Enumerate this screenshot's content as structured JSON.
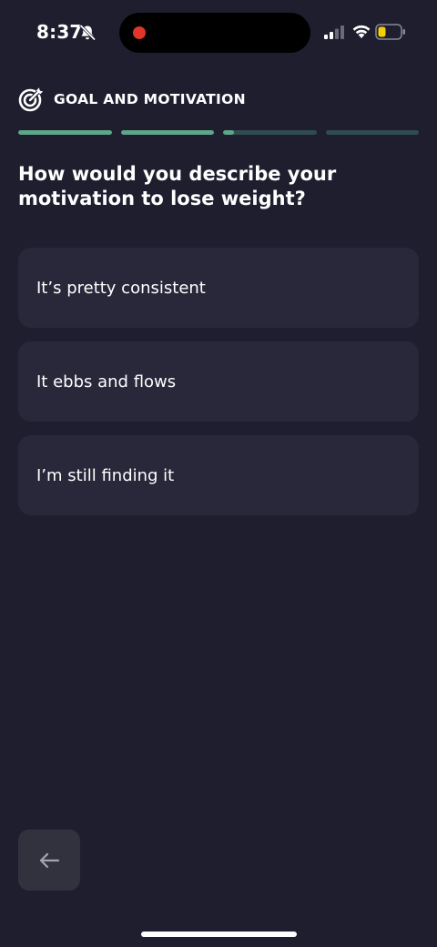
{
  "status_bar": {
    "time": "8:37",
    "icons": [
      "bell-off-icon",
      "recording-dot-icon",
      "cellular-signal-icon",
      "wifi-icon",
      "battery-icon"
    ],
    "recording_color": "#e0352b",
    "battery_color": "#f5d000"
  },
  "header": {
    "icon": "target-icon",
    "title": "GOAL AND MOTIVATION"
  },
  "progress": {
    "segments": [
      {
        "fill": 1.0
      },
      {
        "fill": 1.0
      },
      {
        "fill": 0.12
      },
      {
        "fill": 0.0
      }
    ],
    "fill_color": "#5ea688",
    "track_color": "#2f4d4f"
  },
  "question": "How would you describe your motivation to lose weight?",
  "options": [
    {
      "label": "It’s pretty consistent"
    },
    {
      "label": "It ebbs and flows"
    },
    {
      "label": "I’m still finding it"
    }
  ],
  "back_button": {
    "icon": "arrow-left-icon"
  },
  "colors": {
    "background": "#1e1e2f",
    "card": "#28283a",
    "back_button": "#32323f"
  }
}
